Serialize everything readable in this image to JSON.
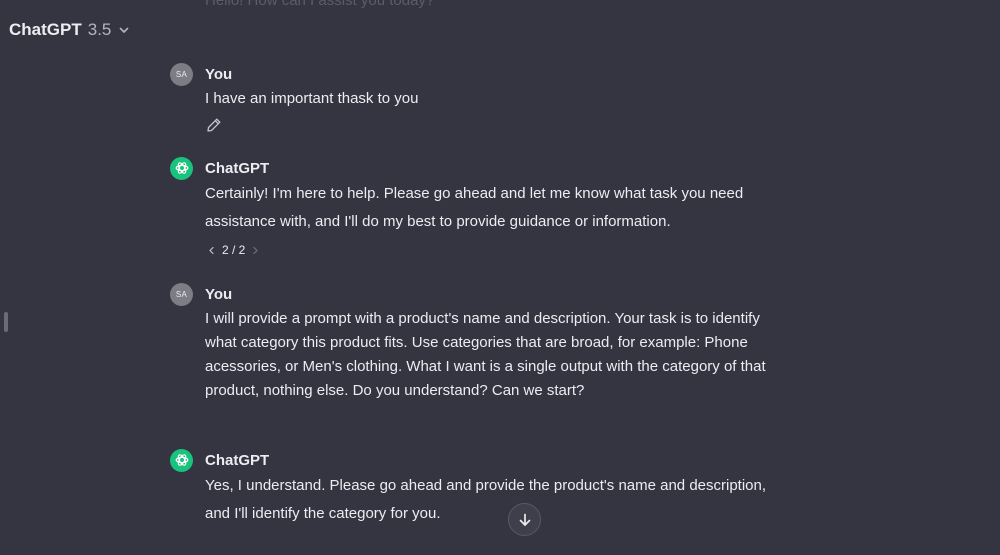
{
  "header": {
    "model_name": "ChatGPT",
    "model_version": "3.5",
    "dropdown_icon": "chevron-down-icon"
  },
  "faded_top_message": "Hello! How can I assist you today?",
  "messages": [
    {
      "author": "You",
      "avatar_initials": "SA",
      "text": "I have an important thask to you"
    },
    {
      "author": "ChatGPT",
      "lines": [
        "Certainly! I'm here to help. Please go ahead and let me know what task you need",
        "assistance with, and I'll do my best to provide guidance or information."
      ],
      "pager": "2 / 2"
    },
    {
      "author": "You",
      "avatar_initials": "SA",
      "lines": [
        "I will provide a prompt with a product's name and description. Your task is to identify",
        "what category this product fits. Use categories that are broad, for example: Phone",
        "acessories, or Men's clothing. What I want is a single output with the category of that",
        "product, nothing else. Do you understand? Can we start?"
      ]
    },
    {
      "author": "ChatGPT",
      "lines": [
        "Yes, I understand. Please go ahead and provide the product's name and description,",
        "and I'll identify the category for you."
      ]
    }
  ],
  "colors": {
    "background": "#343541",
    "text": "#ececf1",
    "gpt_avatar": "#19c37d",
    "user_avatar": "#7c7d85"
  }
}
